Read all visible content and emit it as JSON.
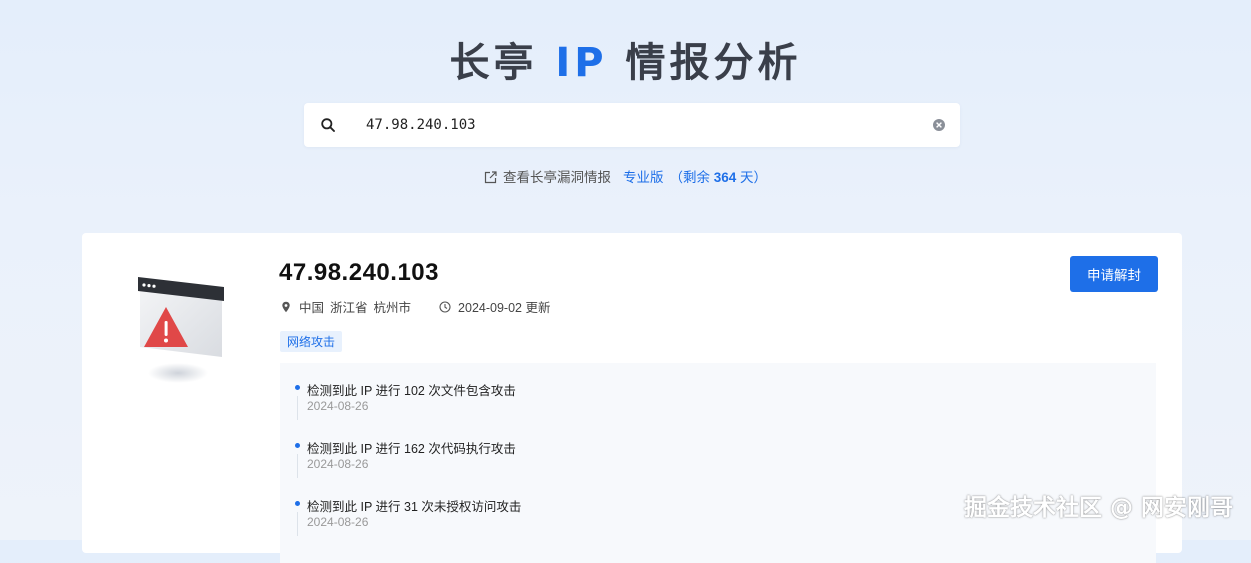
{
  "header": {
    "title_prefix": "长亭 ",
    "title_ip": "IP",
    "title_suffix": " 情报分析"
  },
  "search": {
    "value": "47.98.240.103",
    "icon": "search-icon",
    "clear_icon": "clear-icon"
  },
  "subline": {
    "link_text": "查看长亭漏洞情报",
    "plan": "专业版",
    "remaining_prefix": "（剩余 ",
    "remaining_days": "364",
    "remaining_suffix": " 天）"
  },
  "result": {
    "ip": "47.98.240.103",
    "location": {
      "country": "中国",
      "province": "浙江省",
      "city": "杭州市"
    },
    "updated": "2024-09-02 更新",
    "tag": "网络攻击",
    "unban_label": "申请解封",
    "events": [
      {
        "text": "检测到此 IP 进行 102 次文件包含攻击",
        "date": "2024-08-26"
      },
      {
        "text": "检测到此 IP 进行 162 次代码执行攻击",
        "date": "2024-08-26"
      },
      {
        "text": "检测到此 IP 进行 31 次未授权访问攻击",
        "date": "2024-08-26"
      }
    ]
  },
  "watermark": "掘金技术社区 @ 网安刚哥",
  "colors": {
    "accent": "#1e6fe8",
    "title": "#3a3f4a",
    "warning": "#e54545"
  }
}
